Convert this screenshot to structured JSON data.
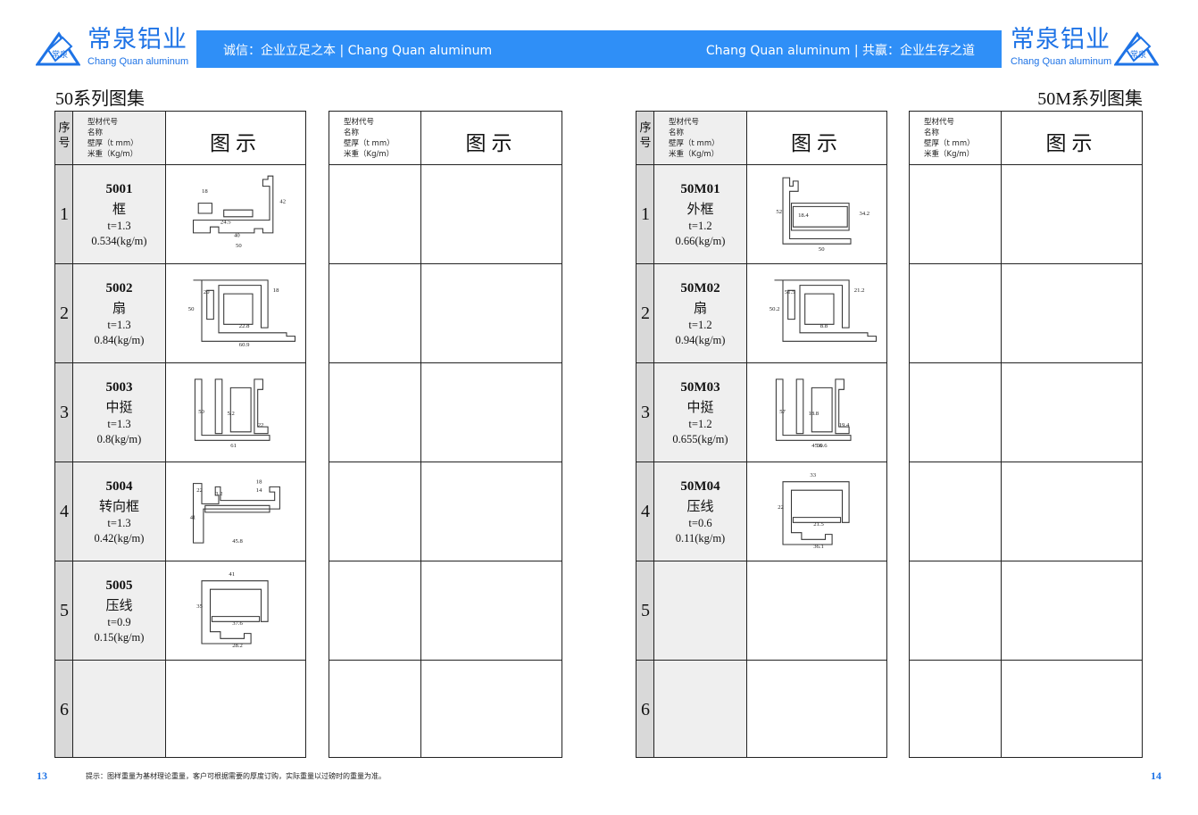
{
  "brand": {
    "name_cn": "常泉铝业",
    "name_en": "Chang Quan aluminum",
    "mark_text": "常泉",
    "color": "#1e73e6"
  },
  "banner": {
    "left": "诚信：企业立足之本 | Chang Quan aluminum",
    "right": "Chang Quan aluminum | 共赢：企业生存之道",
    "color": "#2f8ff7"
  },
  "pages": {
    "left": {
      "series_title": "50系列图集",
      "page_number": "13",
      "header": {
        "seq": "序号",
        "meta": [
          "型材代号",
          "名称",
          "壁厚（t mm）",
          "米重（Kg/m）"
        ],
        "figure": "图示"
      },
      "rows": [
        {
          "seq": "1",
          "code": "5001",
          "name": "框",
          "t": "t=1.3",
          "weight": "0.534(kg/m)",
          "figure_icon": "frame-profile",
          "dims": [
            "18",
            "42",
            "24.5",
            "40",
            "50"
          ]
        },
        {
          "seq": "2",
          "code": "5002",
          "name": "扇",
          "t": "t=1.3",
          "weight": "0.84(kg/m)",
          "figure_icon": "sash-profile",
          "dims": [
            "20",
            "18",
            "50",
            "22.8",
            "60.9"
          ]
        },
        {
          "seq": "3",
          "code": "5003",
          "name": "中挺",
          "t": "t=1.3",
          "weight": "0.8(kg/m)",
          "figure_icon": "mullion-profile",
          "dims": [
            "50",
            "5.2",
            "22",
            "61"
          ]
        },
        {
          "seq": "4",
          "code": "5004",
          "name": "转向框",
          "t": "t=1.3",
          "weight": "0.42(kg/m)",
          "figure_icon": "corner-frame-profile",
          "dims": [
            "22",
            "3.2",
            "18",
            "14",
            "41",
            "45.8"
          ]
        },
        {
          "seq": "5",
          "code": "5005",
          "name": "压线",
          "t": "t=0.9",
          "weight": "0.15(kg/m)",
          "figure_icon": "glazing-bead-profile",
          "dims": [
            "41",
            "35",
            "37.6",
            "28.2"
          ]
        },
        {
          "seq": "6",
          "code": "",
          "name": "",
          "t": "",
          "weight": "",
          "figure_icon": "",
          "dims": []
        }
      ],
      "right_table_header": {
        "meta": [
          "型材代号",
          "名称",
          "壁厚（t mm）",
          "米重（Kg/m）"
        ],
        "figure": "图示"
      }
    },
    "right": {
      "series_title": "50M系列图集",
      "page_number": "14",
      "header": {
        "seq": "序号",
        "meta": [
          "型材代号",
          "名称",
          "壁厚（t mm）",
          "米重（Kg/m）"
        ],
        "figure": "图示"
      },
      "rows": [
        {
          "seq": "1",
          "code": "50M01",
          "name": "外框",
          "t": "t=1.2",
          "weight": "0.66(kg/m)",
          "figure_icon": "outer-frame-profile",
          "dims": [
            "52",
            "18.4",
            "34.2",
            "50"
          ]
        },
        {
          "seq": "2",
          "code": "50M02",
          "name": "扇",
          "t": "t=1.2",
          "weight": "0.94(kg/m)",
          "figure_icon": "sash-profile",
          "dims": [
            "51.5",
            "21.2",
            "50.2",
            "8.8"
          ]
        },
        {
          "seq": "3",
          "code": "50M03",
          "name": "中挺",
          "t": "t=1.2",
          "weight": "0.655(kg/m)",
          "figure_icon": "mullion-profile",
          "dims": [
            "57",
            "18.8",
            "19.4",
            "45.6",
            "50.6"
          ]
        },
        {
          "seq": "4",
          "code": "50M04",
          "name": "压线",
          "t": "t=0.6",
          "weight": "0.11(kg/m)",
          "figure_icon": "glazing-bead-profile",
          "dims": [
            "33",
            "22",
            "21.5",
            "36.1"
          ]
        },
        {
          "seq": "5",
          "code": "",
          "name": "",
          "t": "",
          "weight": "",
          "figure_icon": "",
          "dims": []
        },
        {
          "seq": "6",
          "code": "",
          "name": "",
          "t": "",
          "weight": "",
          "figure_icon": "",
          "dims": []
        }
      ],
      "right_table_header": {
        "meta": [
          "型材代号",
          "名称",
          "壁厚（t mm）",
          "米重（Kg/m）"
        ],
        "figure": "图示"
      }
    }
  },
  "footer_note": "提示：图样重量为基材理论重量，客户可根据需要的厚度订购，实际重量以过磅时的重量为准。"
}
